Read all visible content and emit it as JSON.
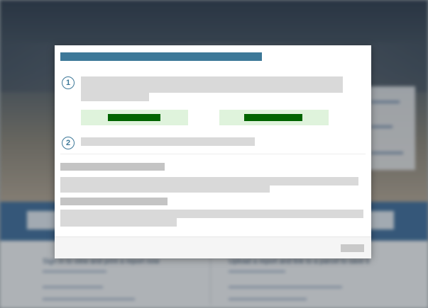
{
  "background": {
    "col_left_title": "Sign in to view and print a report now",
    "col_right_title": "Upload a report and link to a parcel to save it",
    "accent": "#2d5f8f"
  },
  "modal": {
    "header_color": "#3d7898",
    "steps": [
      {
        "number": "1"
      },
      {
        "number": "2"
      }
    ],
    "option_button_color": "#006400",
    "option_button_bg": "#dff3dc"
  }
}
